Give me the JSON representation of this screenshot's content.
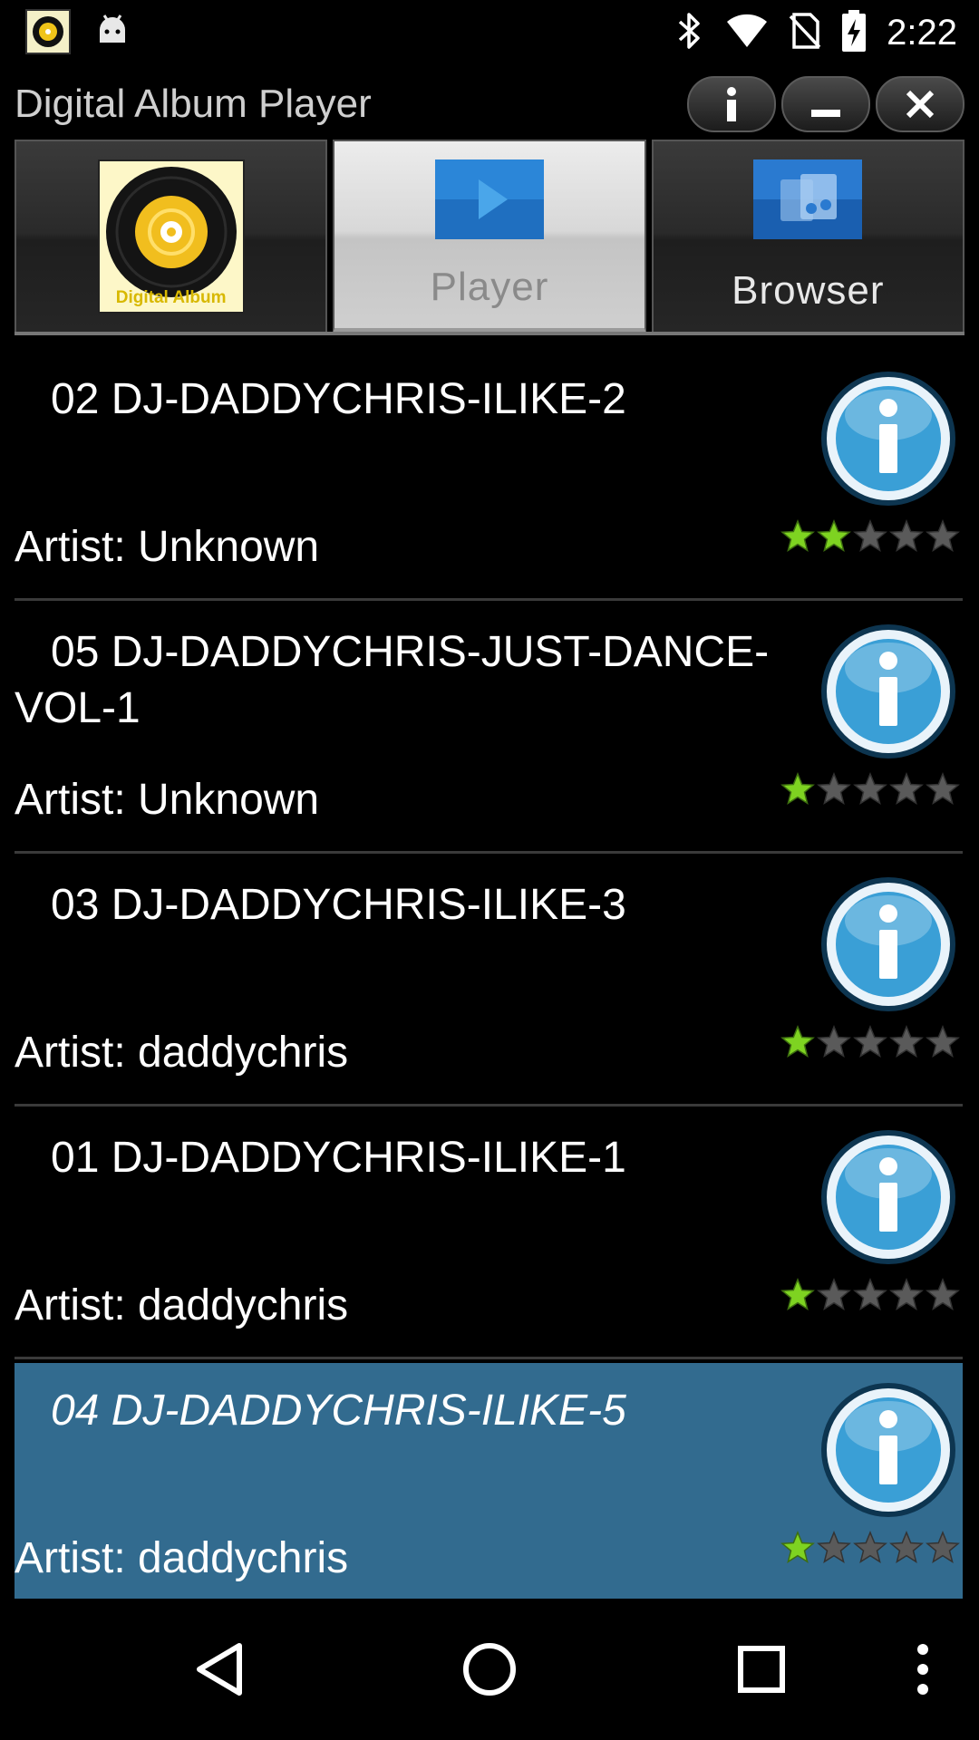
{
  "status_bar": {
    "time": "2:22",
    "icons": [
      "app-thumbnail-icon",
      "android-debug-icon",
      "bluetooth-icon",
      "wifi-icon",
      "no-sim-icon",
      "battery-charging-icon"
    ]
  },
  "app": {
    "title": "Digital Album Player",
    "window_controls": [
      "info-icon",
      "minimize-icon",
      "close-icon"
    ]
  },
  "tabs": [
    {
      "label": "",
      "icon": "digital-album-logo",
      "logo_text": "Digital Album",
      "active": false
    },
    {
      "label": "Player",
      "icon": "play-icon",
      "active": true
    },
    {
      "label": "Browser",
      "icon": "music-folder-icon",
      "active": false
    }
  ],
  "songs": [
    {
      "title": "02 DJ-DADDYCHRIS-ILIKE-2",
      "artist": "Artist: Unknown",
      "rating": 2,
      "selected": false
    },
    {
      "title": "05 DJ-DADDYCHRIS-JUST-DANCE-VOL-1",
      "artist": "Artist: Unknown",
      "rating": 1,
      "selected": false
    },
    {
      "title": "03 DJ-DADDYCHRIS-ILIKE-3",
      "artist": "Artist: daddychris",
      "rating": 1,
      "selected": false
    },
    {
      "title": "01 DJ-DADDYCHRIS-ILIKE-1",
      "artist": "Artist: daddychris",
      "rating": 1,
      "selected": false
    },
    {
      "title": "04 DJ-DADDYCHRIS-ILIKE-5",
      "artist": "Artist: daddychris",
      "rating": 1,
      "selected": true
    }
  ],
  "rating_max": 5,
  "colors": {
    "selected_row": "#326b8f",
    "star_on": "#7ed321",
    "star_off": "#5a5a5a",
    "info_button": "#3a9fd6"
  },
  "nav_bar": [
    "back-icon",
    "home-icon",
    "recents-icon",
    "overflow-menu-icon"
  ]
}
